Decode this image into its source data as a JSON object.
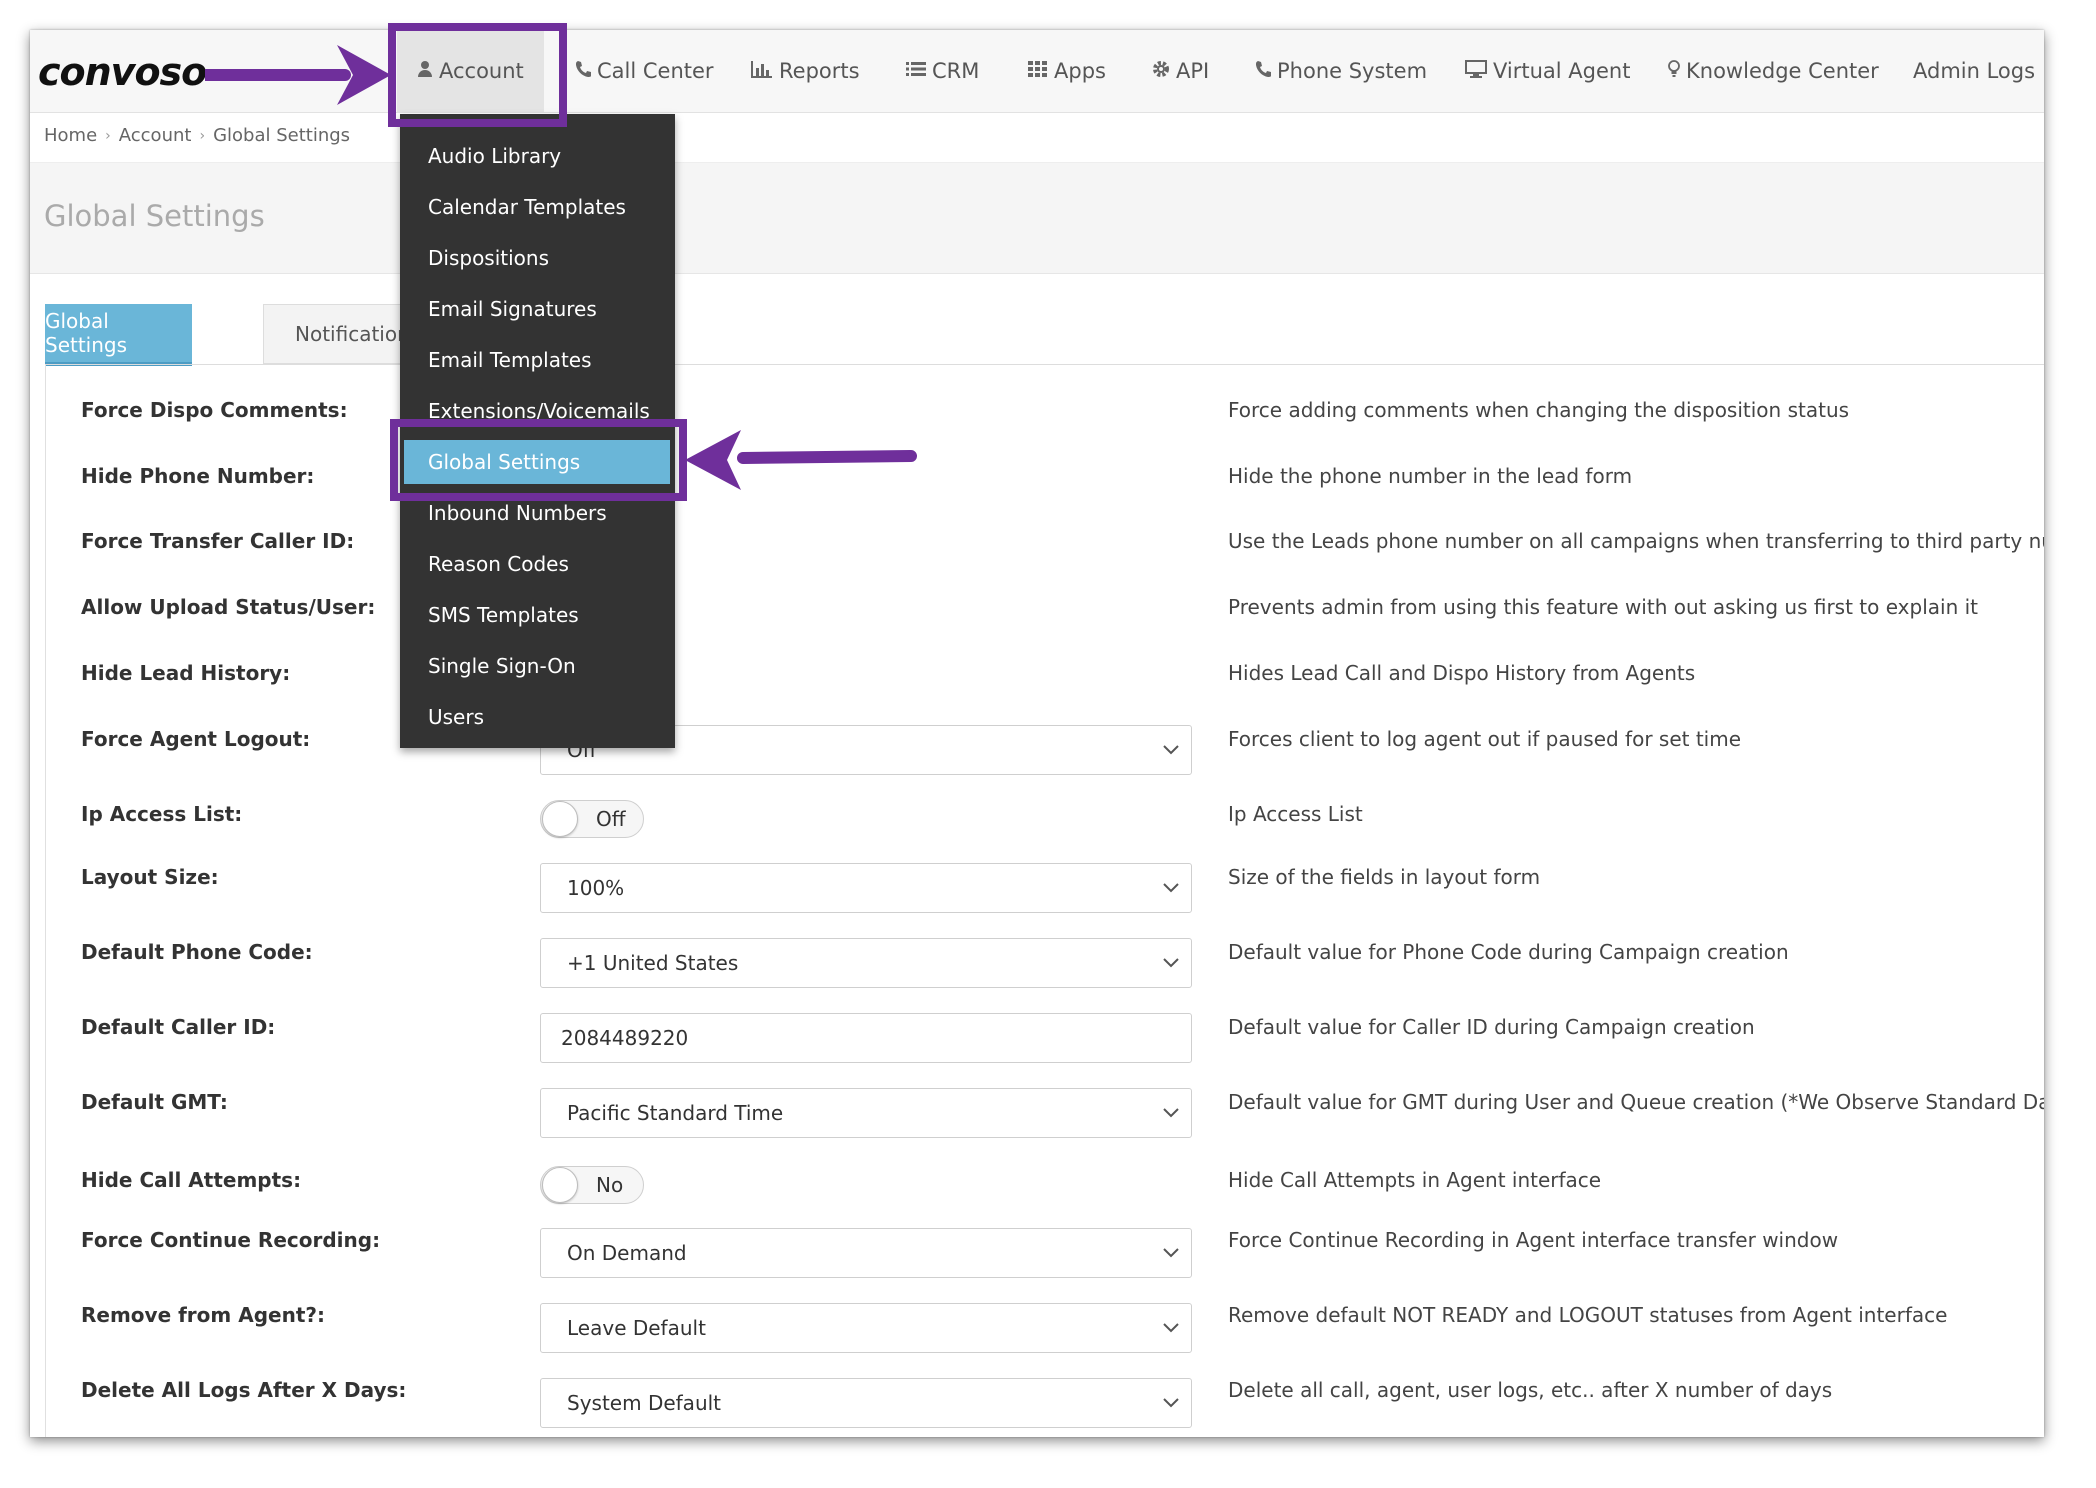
{
  "app": {
    "logo_text": "convoso"
  },
  "nav": {
    "items": [
      {
        "label": "Account",
        "icon": "user-icon"
      },
      {
        "label": "Call Center",
        "icon": "phone-icon"
      },
      {
        "label": "Reports",
        "icon": "bar-chart-icon"
      },
      {
        "label": "CRM",
        "icon": "list-icon"
      },
      {
        "label": "Apps",
        "icon": "grid-icon"
      },
      {
        "label": "API",
        "icon": "gear-icon"
      },
      {
        "label": "Phone System",
        "icon": "phone-icon"
      },
      {
        "label": "Virtual Agent",
        "icon": "monitor-icon"
      },
      {
        "label": "Knowledge Center",
        "icon": "lightbulb-icon"
      },
      {
        "label": "Admin Logs",
        "icon": ""
      }
    ]
  },
  "breadcrumb": [
    "Home",
    "Account",
    "Global Settings"
  ],
  "page": {
    "title": "Global Settings"
  },
  "tabs": [
    {
      "label": "Global Settings",
      "active": true
    },
    {
      "label": "Notification",
      "active": false
    }
  ],
  "dropdown": {
    "items": [
      "Audio Library",
      "Calendar Templates",
      "Dispositions",
      "Email Signatures",
      "Email Templates",
      "Extensions/Voicemails",
      "Global Settings",
      "Inbound Numbers",
      "Reason Codes",
      "SMS Templates",
      "Single Sign-On",
      "Users"
    ],
    "active": "Global Settings"
  },
  "settings": [
    {
      "label": "Force Dispo Comments:",
      "desc": "Force adding comments when changing the disposition status"
    },
    {
      "label": "Hide Phone Number:",
      "desc": "Hide the phone number in the lead form"
    },
    {
      "label": "Force Transfer Caller ID:",
      "desc": "Use the Leads phone number on all campaigns when transferring to third party num"
    },
    {
      "label": "Allow Upload Status/User:",
      "desc": "Prevents admin from using this feature with out asking us first to explain it"
    },
    {
      "label": "Hide Lead History:",
      "desc": "Hides Lead Call and Dispo History from Agents"
    },
    {
      "label": "Force Agent Logout:",
      "desc": "Forces client to log agent out if paused for set time",
      "value": "Off"
    },
    {
      "label": "Ip Access List:",
      "desc": "Ip Access List",
      "value": "Off"
    },
    {
      "label": "Layout Size:",
      "desc": "Size of the fields in layout form",
      "value": "100%"
    },
    {
      "label": "Default Phone Code:",
      "desc": "Default value for Phone Code during Campaign creation",
      "value": "+1 United States"
    },
    {
      "label": "Default Caller ID:",
      "desc": "Default value for Caller ID during Campaign creation",
      "value": "2084489220"
    },
    {
      "label": "Default GMT:",
      "desc": "Default value for GMT during User and Queue creation (*We Observe Standard Dayli",
      "value": "Pacific Standard Time"
    },
    {
      "label": "Hide Call Attempts:",
      "desc": "Hide Call Attempts in Agent interface",
      "value": "No"
    },
    {
      "label": "Force Continue Recording:",
      "desc": "Force Continue Recording in Agent interface transfer window",
      "value": "On Demand"
    },
    {
      "label": "Remove from Agent?:",
      "desc": "Remove default NOT READY and LOGOUT statuses from Agent interface",
      "value": "Leave Default"
    },
    {
      "label": "Delete All Logs After X Days:",
      "desc": "Delete all call, agent, user logs, etc.. after X number of days",
      "value": "System Default"
    }
  ],
  "colors": {
    "accent": "#6ab6d8",
    "annotation": "#6f2f9b",
    "dropdown_bg": "#333333"
  }
}
